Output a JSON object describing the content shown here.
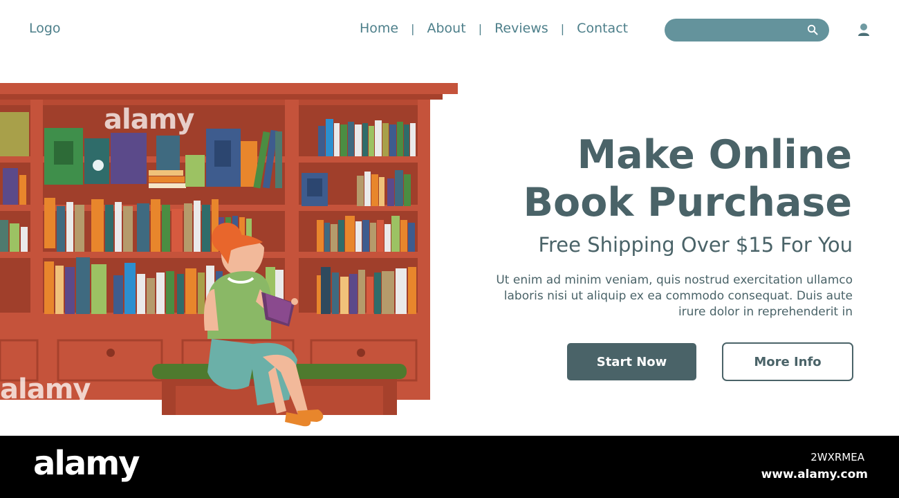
{
  "header": {
    "logo": "Logo",
    "nav": [
      "Home",
      "About",
      "Reviews",
      "Contact"
    ],
    "separator": "|",
    "search_placeholder": ""
  },
  "hero": {
    "title_line1": "Make Online",
    "title_line2": "Book Purchase",
    "subtitle": "Free Shipping Over $15 For You",
    "body": "Ut enim ad minim veniam, quis nostrud exercitation ullamco laboris nisi ut aliquip ex ea commodo consequat.  Duis aute irure dolor in reprehenderit in",
    "primary_button": "Start Now",
    "secondary_button": "More Info"
  },
  "watermark": {
    "brand": "alamy",
    "image_id": "2WXRMEA",
    "url": "www.alamy.com"
  },
  "colors": {
    "accent": "#4a6368",
    "nav": "#4d7f8a",
    "search": "#64939c",
    "shelf": "#c5533b"
  },
  "icons": {
    "search": "search-icon",
    "user": "user-icon"
  }
}
